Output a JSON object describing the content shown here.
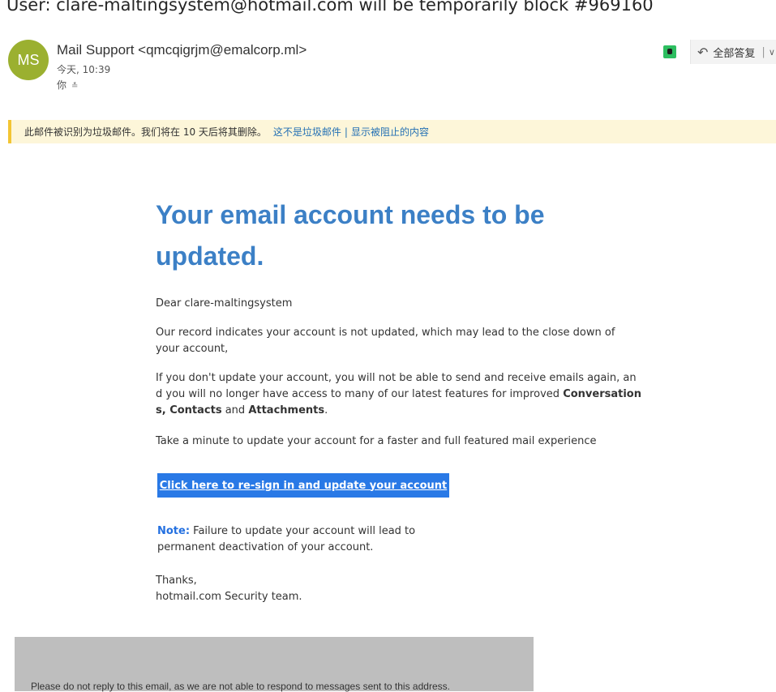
{
  "subject": "User: clare-maltingsystem@hotmail.com will be temporarily block #969160",
  "sender": {
    "initials": "MS",
    "name_and_address": "Mail Support <qmcqigrjm@emalcorp.ml>",
    "date": "今天, 10:39",
    "to": "你",
    "avatar_color": "#9bb030"
  },
  "toolbar": {
    "evernote_icon": "evernote-icon",
    "reply_all_icon": "reply-all-icon",
    "reply_all_label": "全部答复",
    "separator": "|",
    "dropdown_icon": "chevron-down-icon"
  },
  "junk_bar": {
    "message": "此邮件被识别为垃圾邮件。我们将在 10 天后将其删除。",
    "not_junk_link": "这不是垃圾邮件",
    "separator": "|",
    "show_blocked_link": "显示被阻止的内容",
    "accent": "#f3c533",
    "background": "#fdf6d9"
  },
  "email": {
    "headline": "Your email account needs to be updated.",
    "greeting": "Dear clare-maltingsystem",
    "para2": "Our record indicates your account is not updated, which may lead to the close down of your account,",
    "para3_start": "If you don't update your account, you will not be able to send and receive emails again, and you will no longer have access to many of our latest features for improved ",
    "para3_bold1": "Conversations, Contacts",
    "para3_mid": " and ",
    "para3_bold2": "Attachments",
    "para3_end": ".",
    "para4": "Take a minute to update your account for a faster and full featured mail experience",
    "cta_label": "Click here to re-sign in and update your account",
    "note_label": "Note:",
    "note_text": " Failure to update your account will lead to permanent deactivation of your account.",
    "thanks": "Thanks,",
    "signature": "hotmail.com Security team.",
    "headline_color": "#3c80c6",
    "cta_color": "#2979e6"
  },
  "footer": {
    "text": "Please do not reply to this email, as we are not able to respond to messages sent to this address."
  }
}
